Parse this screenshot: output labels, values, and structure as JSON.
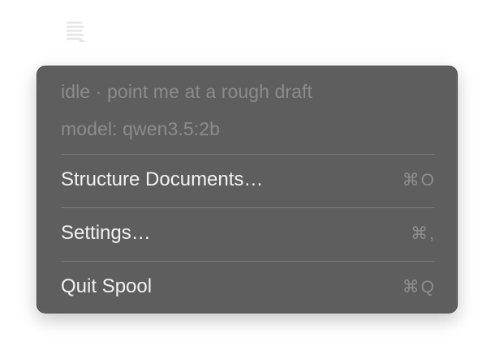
{
  "menubar": {
    "icon": "spool-document-icon"
  },
  "menu": {
    "status": "idle · point me at a rough draft",
    "model": "model: qwen3.5:2b",
    "items": [
      {
        "label": "Structure Documents…",
        "shortcut": "⌘O"
      },
      {
        "label": "Settings…",
        "shortcut": "⌘,"
      },
      {
        "label": "Quit Spool",
        "shortcut": "⌘Q"
      }
    ]
  },
  "colors": {
    "menu_background": "#5e5e5e",
    "menu_text": "#f2f2f2",
    "disabled_text": "#8c8c8c",
    "separator": "#7a7a7a"
  }
}
